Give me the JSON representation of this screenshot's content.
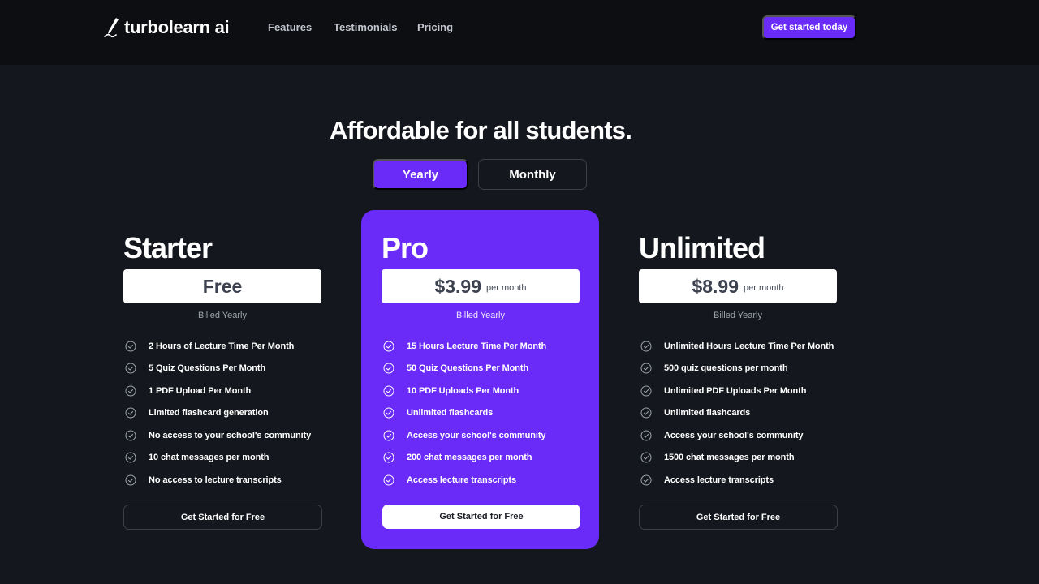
{
  "nav": {
    "logo_text": "turbolearn ai",
    "links": [
      "Features",
      "Testimonials",
      "Pricing"
    ],
    "cta_label": "Get started today"
  },
  "headline": "Affordable for all students.",
  "billing_toggle": {
    "yearly": "Yearly",
    "monthly": "Monthly",
    "selected": "Yearly"
  },
  "plans": [
    {
      "name": "Starter",
      "price": "Free",
      "per": "",
      "billed": "Billed Yearly",
      "features": [
        "2 Hours of Lecture Time Per Month",
        "5 Quiz Questions Per Month",
        "1 PDF Upload Per Month",
        "Limited flashcard generation",
        "No access to your school's community",
        "10 chat messages per month",
        "No access to lecture transcripts"
      ],
      "cta": "Get Started for Free"
    },
    {
      "name": "Pro",
      "price": "$3.99",
      "per": "per month",
      "billed": "Billed Yearly",
      "features": [
        "15 Hours Lecture Time Per Month",
        "50 Quiz Questions Per Month",
        "10 PDF Uploads Per Month",
        "Unlimited flashcards",
        "Access your school's community",
        "200 chat messages per month",
        "Access lecture transcripts"
      ],
      "cta": "Get Started for Free"
    },
    {
      "name": "Unlimited",
      "price": "$8.99",
      "per": "per month",
      "billed": "Billed Yearly",
      "features": [
        "Unlimited Hours Lecture Time Per Month",
        "500 quiz questions per month",
        "Unlimited PDF Uploads Per Month",
        "Unlimited flashcards",
        "Access your school's community",
        "1500 chat messages per month",
        "Access lecture transcripts"
      ],
      "cta": "Get Started for Free"
    }
  ],
  "colors": {
    "accent": "#6a2bf9",
    "background": "#14171d",
    "nav_background": "#0d0e11"
  },
  "icons": {
    "logo": "pen-icon",
    "feature": "check-circle-icon"
  }
}
